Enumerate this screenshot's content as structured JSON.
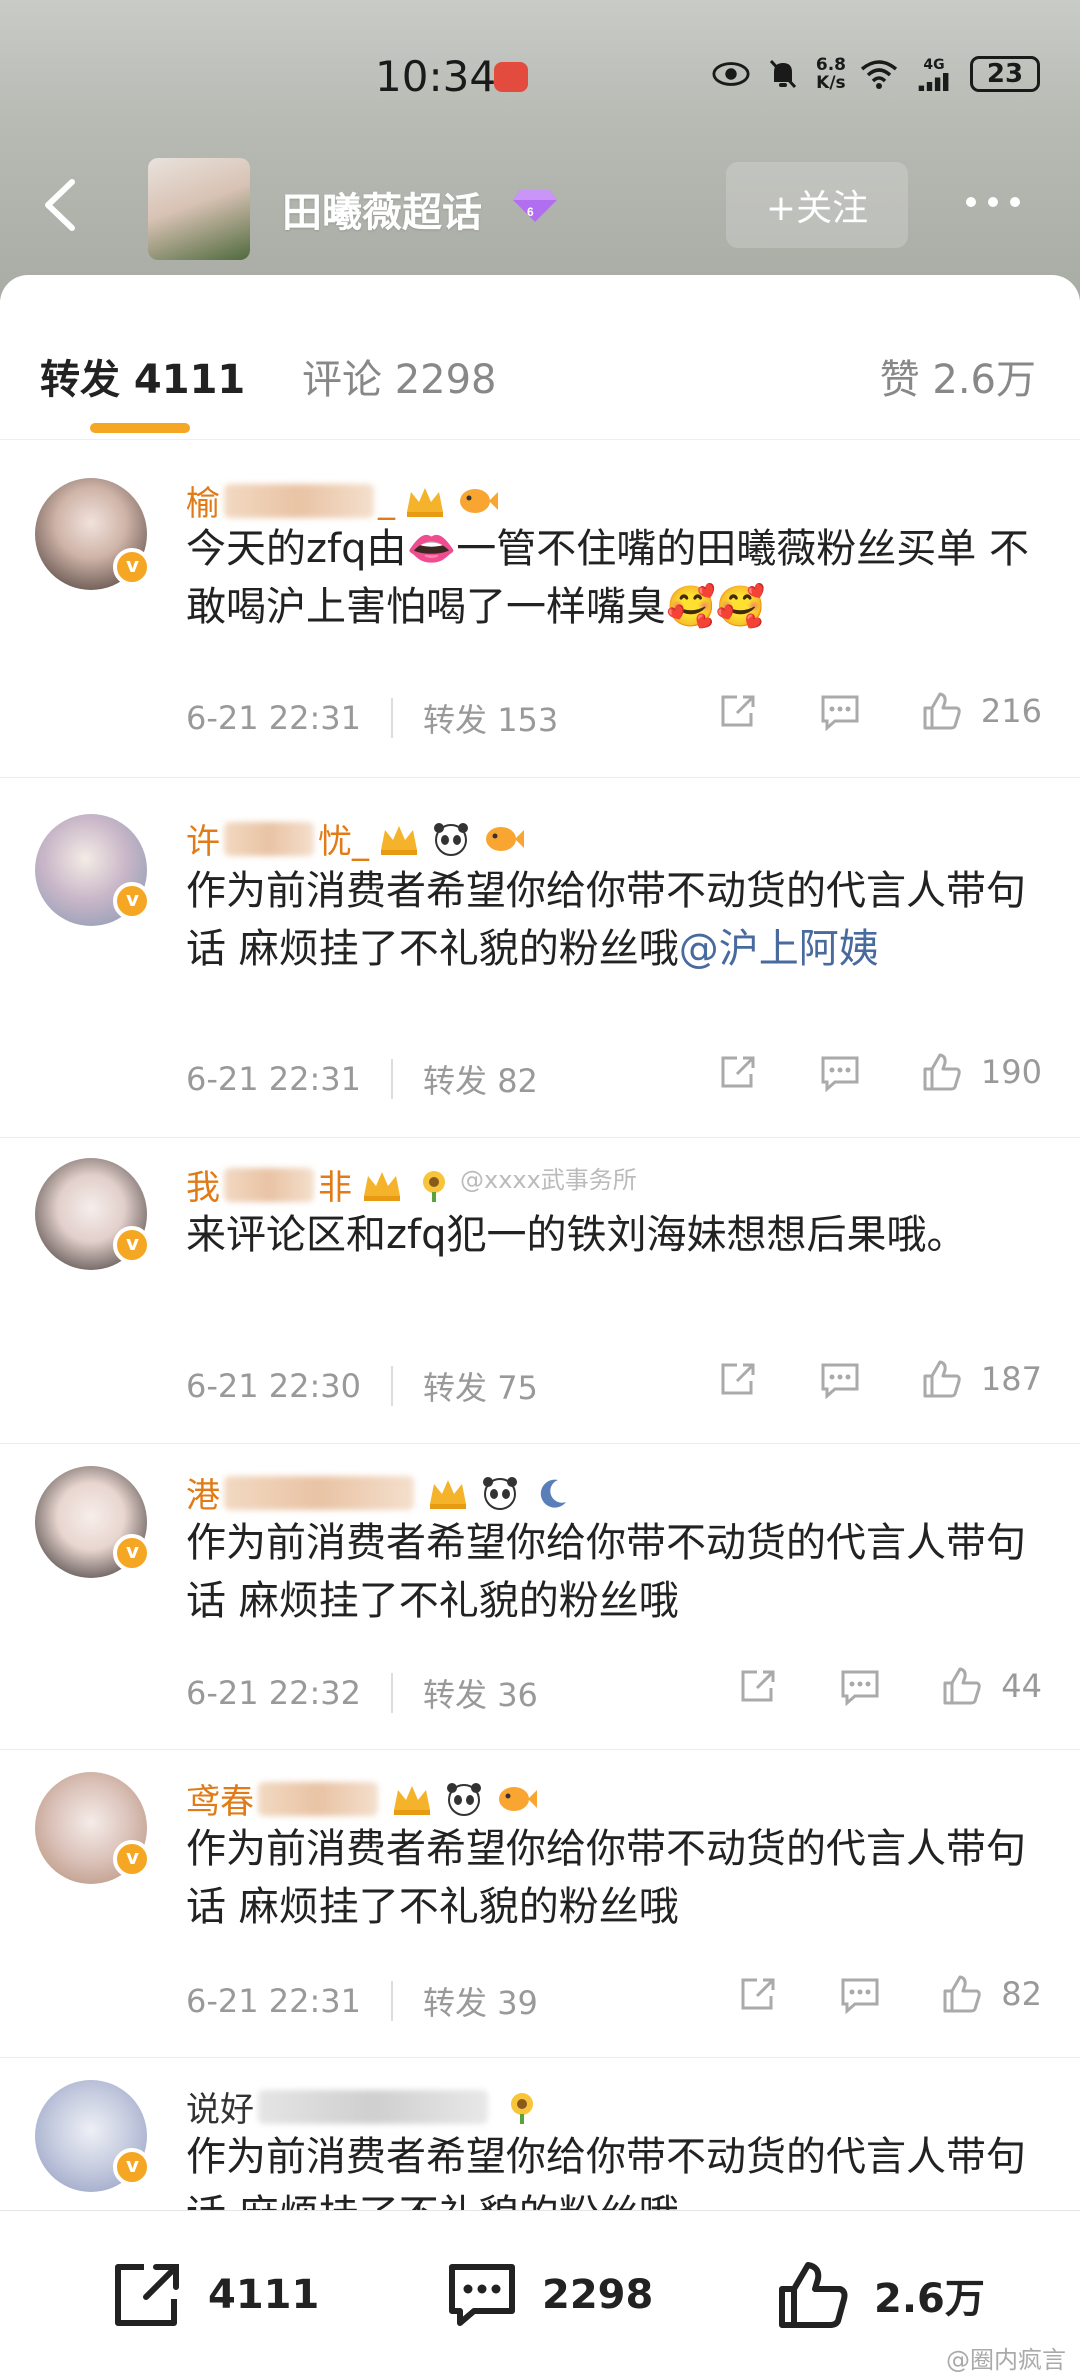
{
  "status_bar": {
    "time": "10:34",
    "speed_value": "6.8",
    "speed_unit": "K/s",
    "network": "4G",
    "battery": "23"
  },
  "nav": {
    "title": "田曦薇超话",
    "follow_label": "+关注"
  },
  "tabs": {
    "repost": "转发 4111",
    "comments": "评论 2298",
    "likes": "赞 2.6万"
  },
  "comments": [
    {
      "name_start": "榆",
      "name_end": "_",
      "text": "今天的zfq由👄一管不住嘴的田曦薇粉丝买单 不敢喝沪上害怕喝了一样嘴臭🥰🥰",
      "time": "6-21 22:31",
      "repost": "转发 153",
      "likes": "216"
    },
    {
      "name_start": "许",
      "name_end": "忧_",
      "text": "作为前消费者希望你给你带不动货的代言人带句话  麻烦挂了不礼貌的粉丝哦",
      "mention": "@沪上阿姨",
      "time": "6-21 22:31",
      "repost": "转发 82",
      "likes": "190"
    },
    {
      "name_start": "我",
      "name_end": "非",
      "text": "来评论区和zfq犯一的铁刘海妹想想后果哦。",
      "time": "6-21 22:30",
      "repost": "转发 75",
      "likes": "187"
    },
    {
      "name_start": "港",
      "name_end": "",
      "text": "作为前消费者希望你给你带不动货的代言人带句话  麻烦挂了不礼貌的粉丝哦",
      "time": "6-21 22:32",
      "repost": "转发 36",
      "likes": "44"
    },
    {
      "name_start": "鸢春",
      "name_end": "",
      "text": "作为前消费者希望你给你带不动货的代言人带句话  麻烦挂了不礼貌的粉丝哦",
      "time": "6-21 22:31",
      "repost": "转发 39",
      "likes": "82"
    },
    {
      "name_start": "说好",
      "name_end": "",
      "text": "作为前消费者希望你给你带不动货的代言人带句话  麻烦挂了不礼貌的粉丝哦",
      "time": "",
      "repost": "",
      "likes": ""
    }
  ],
  "bottom_bar": {
    "repost_count": "4111",
    "comment_count": "2298",
    "like_count": "2.6万"
  },
  "watermarks": {
    "middle": "@xxxx武事务所",
    "bottom": "@圈内疯言"
  },
  "colors": {
    "accent_orange": "#f5a623",
    "username_orange": "#e07b17",
    "mention_blue": "#486a9e"
  }
}
